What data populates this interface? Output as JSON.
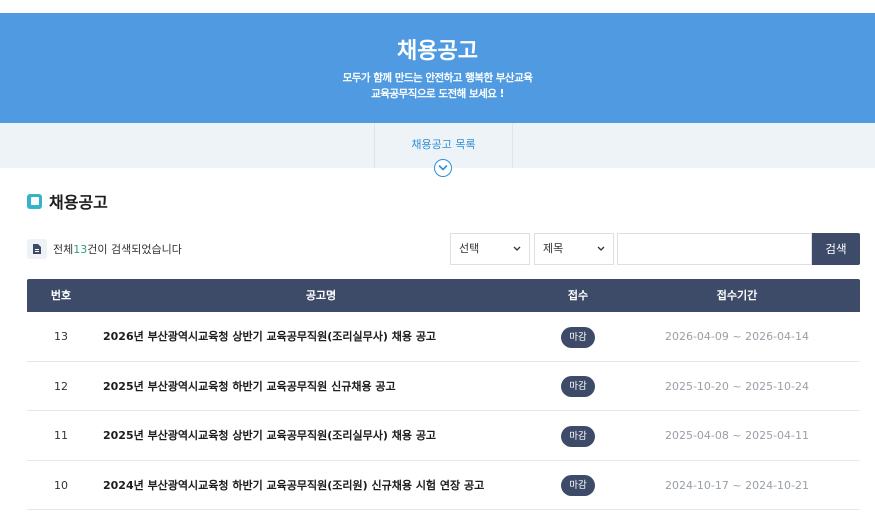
{
  "hero": {
    "title": "채용공고",
    "subtitle_line1": "모두가 함께 만드는 안전하고 행복한 부산교육",
    "subtitle_line2": "교육공무직으로 도전해 보세요 !"
  },
  "subnav": {
    "tab_label": "채용공고 목록"
  },
  "section": {
    "title": "채용공고"
  },
  "summary": {
    "prefix": "전체 ",
    "count": "13",
    "suffix": "건이 검색되었습니다"
  },
  "search": {
    "category_select": "선택",
    "field_select": "제목",
    "query_value": "",
    "button_label": "검색"
  },
  "table": {
    "headers": [
      "번호",
      "공고명",
      "접수",
      "접수기간"
    ],
    "rows": [
      {
        "no": "13",
        "title": "2026년 부산광역시교육청 상반기 교육공무직원(조리실무사) 채용 공고",
        "status": "마감",
        "period": "2026-04-09 ~ 2026-04-14"
      },
      {
        "no": "12",
        "title": "2025년 부산광역시교육청 하반기 교육공무직원 신규채용 공고",
        "status": "마감",
        "period": "2025-10-20 ~ 2025-10-24"
      },
      {
        "no": "11",
        "title": "2025년 부산광역시교육청 상반기 교육공무직원(조리실무사) 채용 공고",
        "status": "마감",
        "period": "2025-04-08 ~ 2025-04-11"
      },
      {
        "no": "10",
        "title": "2024년 부산광역시교육청 하반기 교육공무직원(조리원) 신규채용 시험 연장 공고",
        "status": "마감",
        "period": "2024-10-17 ~ 2024-10-21"
      }
    ]
  },
  "colors": {
    "hero_bg": "#4f9ae0",
    "table_header_bg": "#3d4b68",
    "accent_blue": "#2f8fd8",
    "count_green": "#2aa37a"
  }
}
